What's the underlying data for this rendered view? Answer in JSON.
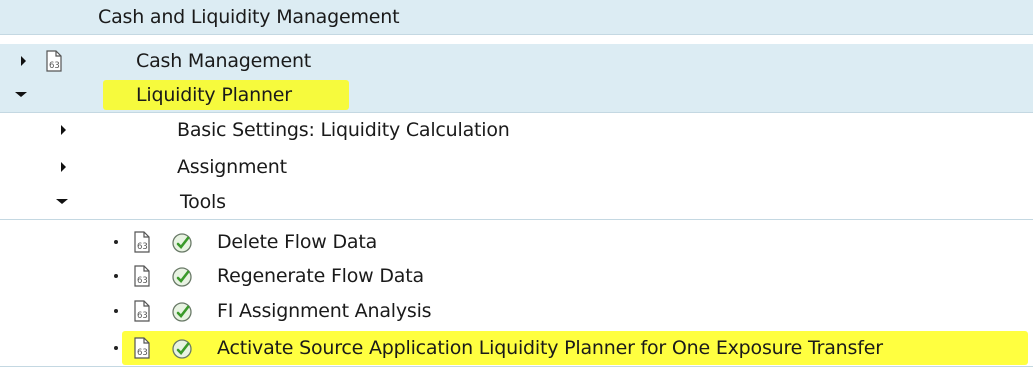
{
  "tree": {
    "root": {
      "label": "Cash and Liquidity Management"
    },
    "cash_management": {
      "label": "Cash Management",
      "expanded": false
    },
    "liquidity_planner": {
      "label": "Liquidity Planner",
      "expanded": true,
      "children": {
        "basic_settings": {
          "label": "Basic Settings: Liquidity Calculation",
          "expanded": false
        },
        "assignment": {
          "label": "Assignment",
          "expanded": false
        },
        "tools": {
          "label": "Tools",
          "expanded": true,
          "items": [
            {
              "label": "Delete Flow Data"
            },
            {
              "label": "Regenerate Flow Data"
            },
            {
              "label": "FI Assignment Analysis"
            },
            {
              "label": "Activate Source Application Liquidity Planner for One Exposure Transfer"
            }
          ]
        }
      }
    }
  },
  "icons": {
    "doc": "documentation-icon",
    "exec": "execute-activity-icon"
  },
  "colors": {
    "row_shade": "#dcecf3",
    "highlight": "#ffff00",
    "exec_green": "#3a9a2a"
  }
}
